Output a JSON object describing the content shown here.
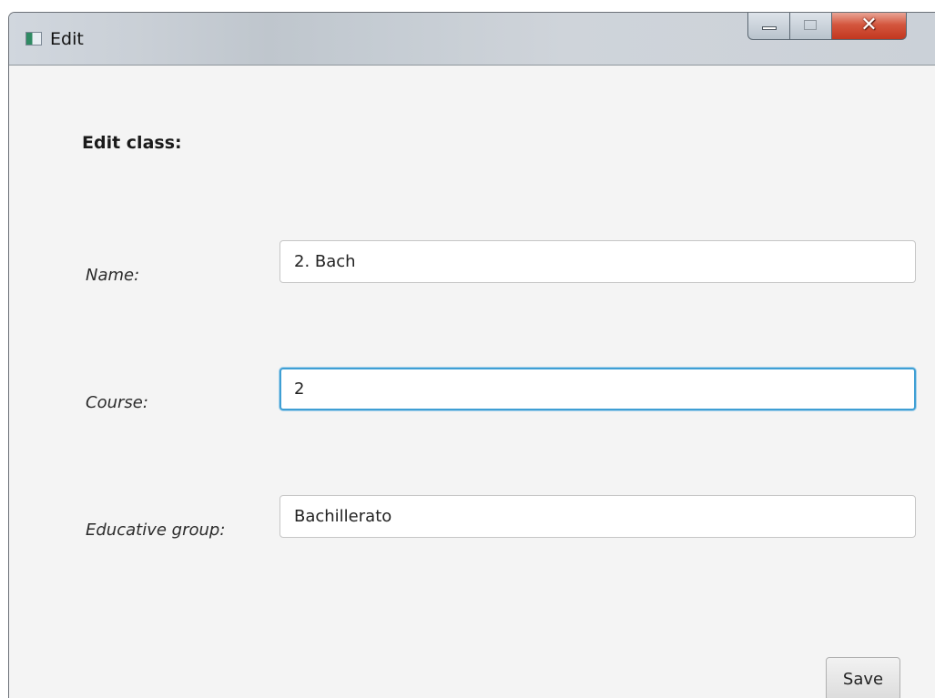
{
  "window": {
    "title": "Edit"
  },
  "form": {
    "heading": "Edit class:",
    "name_label": "Name:",
    "name_value": "2. Bach",
    "course_label": "Course:",
    "course_value": "2",
    "group_label": "Educative group:",
    "group_value": "Bachillerato",
    "save_label": "Save"
  },
  "icons": {
    "app": "app-window-icon",
    "minimize": "minimize-icon",
    "maximize": "maximize-icon",
    "close": "close-icon"
  },
  "colors": {
    "focus_border": "#3f9fd4",
    "close_button": "#c2371f",
    "background": "#f4f4f4"
  }
}
